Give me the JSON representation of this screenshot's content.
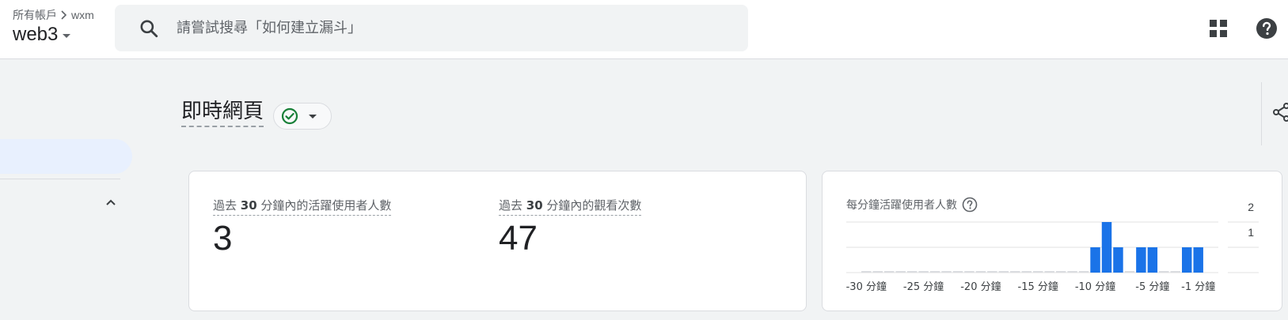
{
  "header": {
    "breadcrumb_root": "所有帳戶",
    "breadcrumb_account": "wxm",
    "property_name": "web3",
    "search_placeholder": "請嘗試搜尋「如何建立漏斗」"
  },
  "page": {
    "title": "即時網頁",
    "status": "ok"
  },
  "metrics": {
    "active_users": {
      "label_prefix": "過去 ",
      "label_num": "30",
      "label_suffix": " 分鐘內的活躍使用者人數",
      "value": "3"
    },
    "views": {
      "label_prefix": "過去 ",
      "label_num": "30",
      "label_suffix": " 分鐘內的觀看次數",
      "value": "47"
    }
  },
  "chart": {
    "title": "每分鐘活躍使用者人數"
  },
  "chart_data": {
    "type": "bar",
    "title": "每分鐘活躍使用者人數",
    "x": [
      -31,
      -30,
      -29,
      -28,
      -27,
      -26,
      -25,
      -24,
      -23,
      -22,
      -21,
      -20,
      -19,
      -18,
      -17,
      -16,
      -15,
      -14,
      -13,
      -12,
      -11,
      -10,
      -9,
      -8,
      -7,
      -6,
      -5,
      -4,
      -3,
      -2,
      -1,
      0
    ],
    "values": [
      0,
      0,
      0,
      0,
      0,
      0,
      0,
      0,
      0,
      0,
      0,
      0,
      0,
      0,
      0,
      0,
      0,
      0,
      0,
      0,
      0,
      1,
      2,
      1,
      0,
      1,
      1,
      0,
      0,
      1,
      1,
      0
    ],
    "x_tick_labels": [
      "-30 分鐘",
      "-25 分鐘",
      "-20 分鐘",
      "-15 分鐘",
      "-10 分鐘",
      "-5 分鐘",
      "-1 分鐘"
    ],
    "x_tick_values": [
      -30,
      -25,
      -20,
      -15,
      -10,
      -5,
      -1
    ],
    "y_tick_labels": [
      "2",
      "1"
    ],
    "y_tick_values": [
      2,
      1
    ],
    "ylim": [
      0,
      2
    ],
    "grid": true,
    "colors": {
      "bar": "#1a73e8",
      "empty": "#dadce0",
      "grid": "#e0e0e0",
      "tick_text": "#3c4043"
    }
  },
  "colors": {
    "accent": "#1a73e8",
    "check_green": "#188038",
    "selected_nav_bg": "#e8f0fe"
  }
}
